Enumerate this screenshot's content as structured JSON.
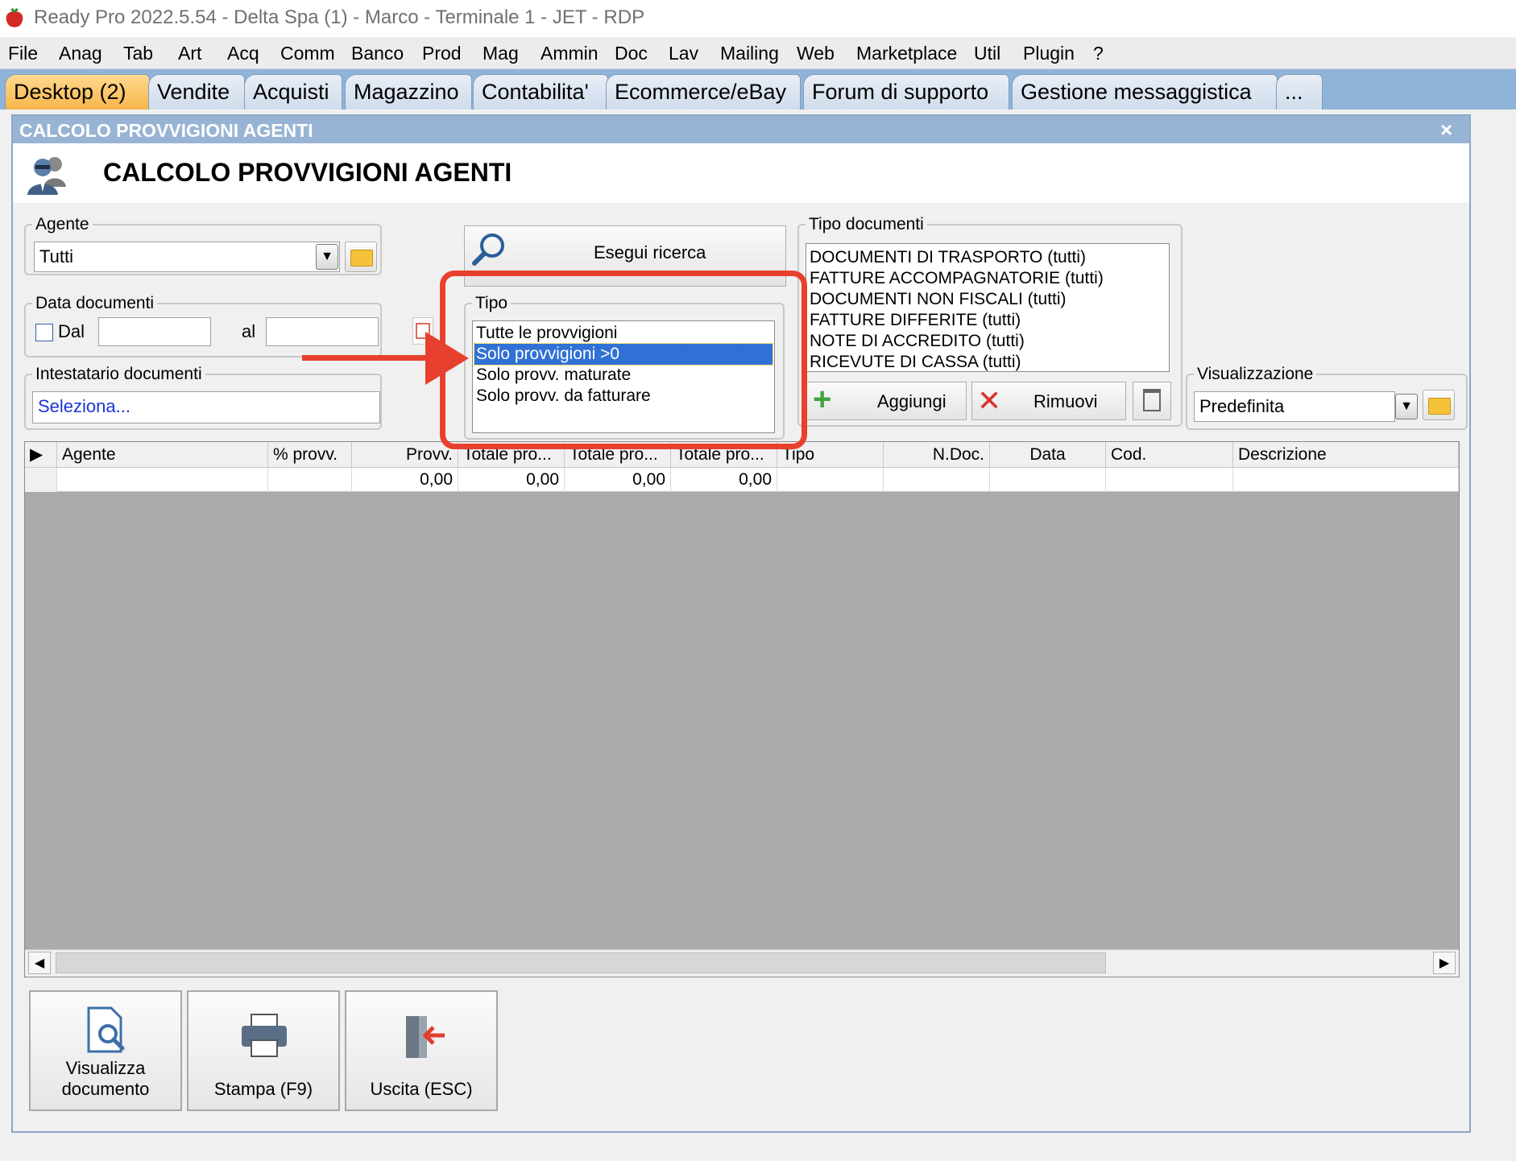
{
  "app": {
    "title": "Ready Pro 2022.5.54 - Delta Spa (1) - Marco - Terminale 1 - JET - RDP"
  },
  "menu": [
    "File",
    "Anag",
    "Tab",
    "Art",
    "Acq",
    "Comm",
    "Banco",
    "Prod",
    "Mag",
    "Ammin",
    "Doc",
    "Lav",
    "Mailing",
    "Web",
    "Marketplace",
    "Util",
    "Plugin",
    "?"
  ],
  "tabs": [
    "Desktop (2)",
    "Vendite",
    "Acquisti",
    "Magazzino",
    "Contabilita'",
    "Ecommerce/eBay",
    "Forum di supporto",
    "Gestione messaggistica",
    "..."
  ],
  "window": {
    "title": "CALCOLO PROVVIGIONI AGENTI",
    "close_glyph": "×",
    "header_title": "CALCOLO PROVVIGIONI AGENTI"
  },
  "agente": {
    "legend": "Agente",
    "value": "Tutti"
  },
  "data_documenti": {
    "legend": "Data documenti",
    "dal_label": "Dal",
    "al_label": "al",
    "dal_value": "",
    "al_value": "",
    "dal_checked": false
  },
  "intestatario": {
    "legend": "Intestatario documenti",
    "value": "Seleziona..."
  },
  "search_button": {
    "label": "Esegui ricerca"
  },
  "tipo": {
    "legend": "Tipo",
    "items": [
      "Tutte le provvigioni",
      "Solo provvigioni >0",
      "Solo provv. maturate",
      "Solo provv. da fatturare"
    ],
    "selected_index": 1
  },
  "tipo_documenti": {
    "legend": "Tipo documenti",
    "items": [
      "DOCUMENTI DI TRASPORTO (tutti)",
      "FATTURE ACCOMPAGNATORIE (tutti)",
      "DOCUMENTI NON FISCALI (tutti)",
      "FATTURE DIFFERITE (tutti)",
      "NOTE DI ACCREDITO (tutti)",
      "RICEVUTE DI CASSA (tutti)"
    ],
    "add_label": "Aggiungi",
    "remove_label": "Rimuovi"
  },
  "visualizzazione": {
    "legend": "Visualizzazione",
    "value": "Predefinita"
  },
  "grid": {
    "columns": [
      "Agente",
      "% provv.",
      "Provv.",
      "Totale pro...",
      "Totale pro...",
      "Totale pro...",
      "Tipo",
      "N.Doc.",
      "Data",
      "Cod.",
      "Descrizione"
    ],
    "row": [
      "",
      "",
      "0,00",
      "0,00",
      "0,00",
      "0,00",
      "",
      "",
      "",
      "",
      ""
    ]
  },
  "bottom_buttons": {
    "view": "Visualizza documento",
    "print": "Stampa (F9)",
    "exit": "Uscita (ESC)"
  },
  "colors": {
    "annotation": "#e8402e",
    "selection": "#3071d5",
    "tabbar": "#8fb4d8",
    "active_tab": "#f7b64a"
  }
}
